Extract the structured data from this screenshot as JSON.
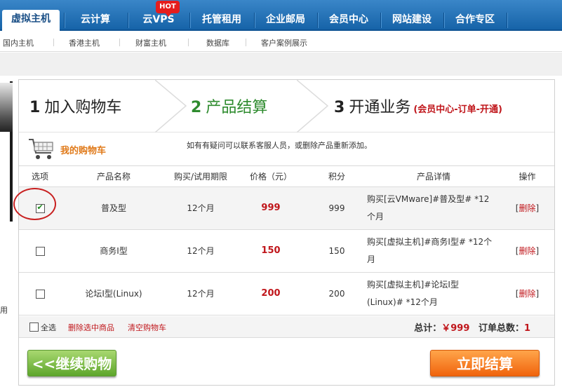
{
  "nav": {
    "items": [
      {
        "label": "虚拟主机",
        "active": true
      },
      {
        "label": "云计算"
      },
      {
        "label": "云VPS"
      },
      {
        "label": "托管租用"
      },
      {
        "label": "企业邮局"
      },
      {
        "label": "会员中心"
      },
      {
        "label": "网站建设"
      },
      {
        "label": "合作专区"
      }
    ],
    "hot_badge": "HOT"
  },
  "subnav": {
    "items": [
      "国内主机",
      "香港主机",
      "财富主机",
      "数据库",
      "客户案例展示"
    ]
  },
  "left_strip_char": "用",
  "steps": [
    {
      "num": "1",
      "label": "加入购物车"
    },
    {
      "num": "2",
      "label": "产品结算",
      "current": true
    },
    {
      "num": "3",
      "label": "开通业务",
      "note": "(会员中心-订单-开通)"
    }
  ],
  "cart": {
    "title": "我的购物车",
    "tip": "如有有疑问可以联系客服人员，或删除产品重新添加。",
    "columns": [
      "选项",
      "产品名称",
      "购买/试用期限",
      "价格（元）",
      "积分",
      "产品详情",
      "操作"
    ],
    "rows": [
      {
        "checked": true,
        "name": "普及型",
        "term": "12个月",
        "price": "999",
        "points": "999",
        "detail": "购买[云VMware]#普及型# *12个月",
        "action": "删除"
      },
      {
        "checked": false,
        "name": "商务I型",
        "term": "12个月",
        "price": "150",
        "points": "150",
        "detail": "购买[虚拟主机]#商务I型# *12个月",
        "action": "删除"
      },
      {
        "checked": false,
        "name": "论坛I型(Linux)",
        "term": "12个月",
        "price": "200",
        "points": "200",
        "detail": "购买[虚拟主机]#论坛I型(Linux)# *12个月",
        "action": "删除"
      }
    ],
    "footer": {
      "select_all": "全选",
      "delete_selected": "删除选中商品",
      "clear_cart": "清空购物车",
      "total_label": "总计：",
      "total_value": "￥999",
      "order_count_label": "订单总数：",
      "order_count_value": "1"
    }
  },
  "buttons": {
    "continue": "<<继续购物",
    "checkout": "立即结算"
  },
  "colors": {
    "nav_blue": "#1663a8",
    "price_red": "#c0161b",
    "current_step_green": "#2e8b2e",
    "checkout_orange": "#f0640d",
    "continue_green": "#5ea62c"
  }
}
